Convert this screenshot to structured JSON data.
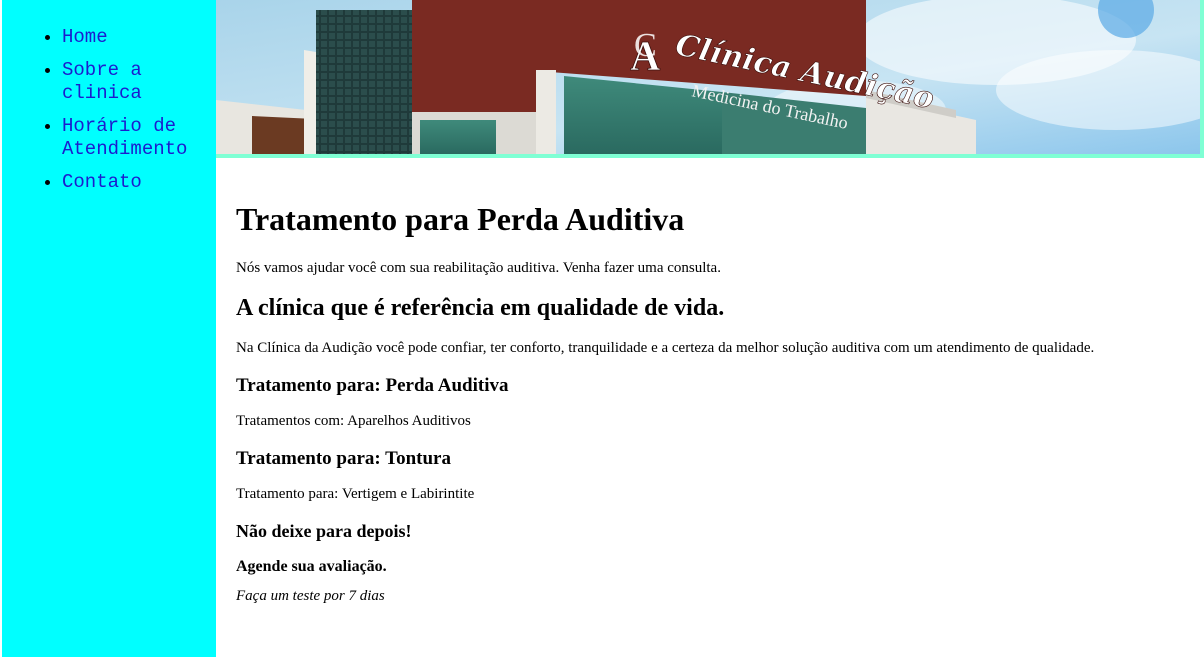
{
  "sidebar": {
    "items": [
      {
        "label": "Home"
      },
      {
        "label": "Sobre a clinica"
      },
      {
        "label": "Horário de Atendimento"
      },
      {
        "label": "Contato"
      }
    ]
  },
  "banner": {
    "logo_mark": "CA",
    "brand_name": "Clínica Audição",
    "brand_subtitle": "Medicina do Trabalho"
  },
  "main": {
    "title": "Tratamento para Perda Auditiva",
    "intro": "Nós vamos ajudar você com sua reabilitação auditiva. Venha fazer uma consulta.",
    "subtitle": "A clínica que é referência em qualidade de vida.",
    "description": "Na Clínica da Audição você pode confiar, ter conforto, tranquilidade e a certeza da melhor solução auditiva com um atendimento de qualidade.",
    "treatment1_heading": "Tratamento para: Perda Auditiva",
    "treatment1_text": "Tratamentos com: Aparelhos Auditivos",
    "treatment2_heading": "Tratamento para: Tontura",
    "treatment2_text": "Tratamento para: Vertigem e Labirintite",
    "cta_heading": "Não deixe para depois!",
    "cta_sub": "Agende sua avaliação.",
    "cta_trial": "Faça um teste por 7 dias"
  },
  "colors": {
    "sidebar_bg": "#00ffff",
    "banner_border": "#7fffd4",
    "link": "#1c1cce",
    "building_red": "#7a2a22"
  }
}
